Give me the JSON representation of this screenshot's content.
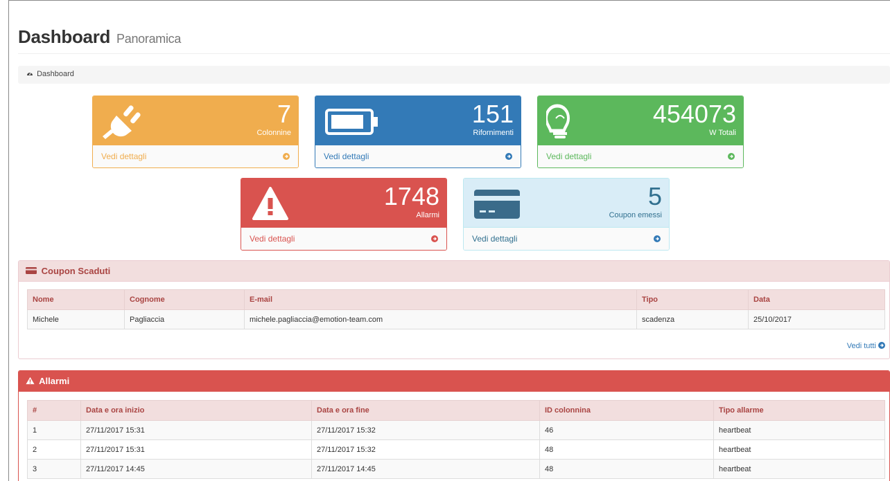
{
  "header": {
    "title": "Dashboard",
    "subtitle": "Panoramica"
  },
  "breadcrumb": {
    "label": "Dashboard",
    "icon": "dashboard-icon"
  },
  "cards": [
    {
      "value": "7",
      "label": "Colonnine",
      "link": "Vedi dettagli",
      "icon": "plug-icon",
      "color": "#f0ad4e"
    },
    {
      "value": "151",
      "label": "Rifornimenti",
      "link": "Vedi dettagli",
      "icon": "battery-icon",
      "color": "#337ab7"
    },
    {
      "value": "454073",
      "label": "W Totali",
      "link": "Vedi dettagli",
      "icon": "lightbulb-icon",
      "color": "#5cb85c"
    },
    {
      "value": "1748",
      "label": "Allarmi",
      "link": "Vedi dettagli",
      "icon": "warning-icon",
      "color": "#d9534f"
    },
    {
      "value": "5",
      "label": "Coupon emessi",
      "link": "Vedi dettagli",
      "icon": "credit-card-icon",
      "color": "#d9edf7"
    }
  ],
  "coupon_panel": {
    "title": "Coupon Scaduti",
    "columns": [
      "Nome",
      "Cognome",
      "E-mail",
      "Tipo",
      "Data"
    ],
    "rows": [
      [
        "Michele",
        "Pagliaccia",
        "michele.pagliaccia@emotion-team.com",
        "scadenza",
        "25/10/2017"
      ]
    ],
    "view_all": "Vedi tutti"
  },
  "alarm_panel": {
    "title": "Allarmi",
    "columns": [
      "#",
      "Data e ora inizio",
      "Data e ora fine",
      "ID colonnina",
      "Tipo allarme"
    ],
    "rows": [
      [
        "1",
        "27/11/2017 15:31",
        "27/11/2017 15:32",
        "46",
        "heartbeat"
      ],
      [
        "2",
        "27/11/2017 15:31",
        "27/11/2017 15:32",
        "48",
        "heartbeat"
      ],
      [
        "3",
        "27/11/2017 14:45",
        "27/11/2017 14:45",
        "48",
        "heartbeat"
      ]
    ]
  }
}
